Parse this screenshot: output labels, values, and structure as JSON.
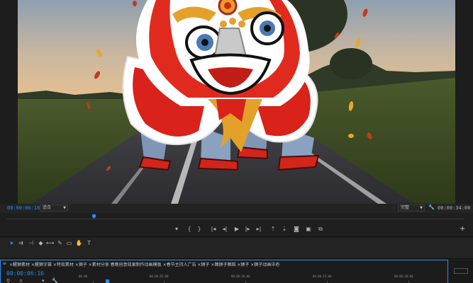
{
  "monitor": {
    "current_timecode": "00:00:06:16",
    "zoom_label": "适合",
    "quality_label": "完整",
    "duration_timecode": "00:00:34:00",
    "playhead_position": 0.19
  },
  "transport": {
    "buttons": [
      {
        "name": "marker-icon",
        "glyph": "▾"
      },
      {
        "name": "mark-in-icon",
        "glyph": "{"
      },
      {
        "name": "mark-out-icon",
        "glyph": "}"
      },
      {
        "name": "go-to-in-icon",
        "glyph": "|◂"
      },
      {
        "name": "step-back-icon",
        "glyph": "◂|"
      },
      {
        "name": "play-icon",
        "glyph": "▶"
      },
      {
        "name": "step-forward-icon",
        "glyph": "|▸"
      },
      {
        "name": "go-to-out-icon",
        "glyph": "▸|"
      },
      {
        "name": "lift-icon",
        "glyph": "⇡"
      },
      {
        "name": "extract-icon",
        "glyph": "⇣"
      },
      {
        "name": "export-frame-icon",
        "glyph": "◙"
      },
      {
        "name": "comparison-view-icon",
        "glyph": "▣"
      },
      {
        "name": "vr-icon",
        "glyph": "⧉"
      }
    ],
    "add_label": "+"
  },
  "tools": [
    {
      "name": "selection-tool-icon",
      "glyph": "➤",
      "active": true
    },
    {
      "name": "track-select-tool-icon",
      "glyph": "⇉",
      "active": false
    },
    {
      "name": "ripple-edit-tool-icon",
      "glyph": "⊣",
      "active": false
    },
    {
      "name": "razor-tool-icon",
      "glyph": "◆",
      "active": false
    },
    {
      "name": "slip-tool-icon",
      "glyph": "⟷",
      "active": false
    },
    {
      "name": "pen-tool-icon",
      "glyph": "✎",
      "active": false
    },
    {
      "name": "rectangle-tool-icon",
      "glyph": "▭",
      "active": false
    },
    {
      "name": "hand-tool-icon",
      "glyph": "✋",
      "active": false
    },
    {
      "name": "type-tool-icon",
      "glyph": "T",
      "active": false
    }
  ],
  "timeline": {
    "menu_glyph": "≡",
    "sequence_tabs": "×醒狮素材 ×醒狮字幕 ×特效素材 ×狮子 ×素材分享 春晚创意效果制作动画模板 ×春节主持人广告 ×狮子 ×舞狮子舞蹈 ×狮子 ×狮子动画中心",
    "close_glyph": "≡",
    "timecode": "00:00:06:16",
    "ruler_labels": [
      "00:00",
      "00:00:05:00",
      "00:00:10:00",
      "00:00:15:00",
      "00:00:20:00"
    ],
    "tools": [
      {
        "name": "snap-icon",
        "glyph": "⚲"
      },
      {
        "name": "linked-selection-icon",
        "glyph": "∩"
      },
      {
        "name": "add-marker-icon",
        "glyph": "▾"
      },
      {
        "name": "timeline-settings-icon",
        "glyph": "🔧"
      }
    ]
  },
  "colors": {
    "accent": "#2d8ceb",
    "panel_bg": "#1e1e1e"
  }
}
